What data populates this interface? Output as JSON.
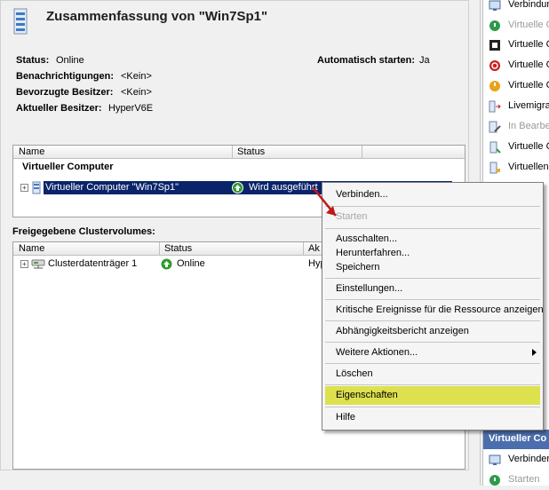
{
  "summary": {
    "title": "Zusammenfassung von \"Win7Sp1\"",
    "status_label": "Status:",
    "status_value": "Online",
    "notify_label": "Benachrichtigungen:",
    "notify_value": "<Kein>",
    "preferred_label": "Bevorzugte Besitzer:",
    "preferred_value": "<Kein>",
    "owner_label": "Aktueller Besitzer:",
    "owner_value": "HyperV6E",
    "autostart_label": "Automatisch starten:",
    "autostart_value": "Ja"
  },
  "vm_table": {
    "col_name": "Name",
    "col_status": "Status",
    "group": "Virtueller Computer",
    "row_name": "Virtueller Computer \"Win7Sp1\"",
    "row_status": "Wird ausgeführt"
  },
  "volumes": {
    "heading": "Freigegebene Clustervolumes:",
    "col_name": "Name",
    "col_status": "Status",
    "col_3": "Ak",
    "row_name": "Clusterdatenträger 1",
    "row_status": "Online",
    "row_col3": "Hyp"
  },
  "context_menu": {
    "connect": "Verbinden...",
    "start": "Starten",
    "shutdown_off": "Ausschalten...",
    "shutdown": "Herunterfahren...",
    "save": "Speichern",
    "settings": "Einstellungen...",
    "critical_events": "Kritische Ereignisse für die Ressource anzeigen",
    "dependency_report": "Abhängigkeitsbericht anzeigen",
    "more_actions": "Weitere Aktionen...",
    "delete": "Löschen",
    "properties": "Eigenschaften",
    "help": "Hilfe",
    "highlight_color": "#dde14e"
  },
  "actions_pane": {
    "items": [
      {
        "label": "Verbindun",
        "icon": "connect-icon"
      },
      {
        "label": "Virtuelle C",
        "icon": "start-icon"
      },
      {
        "label": "Virtuelle C",
        "icon": "stop-icon"
      },
      {
        "label": "Virtuelle C",
        "icon": "power-off-icon"
      },
      {
        "label": "Virtuelle C",
        "icon": "shutdown-icon"
      },
      {
        "label": "Livemigra",
        "icon": "migration-icon"
      },
      {
        "label": "In Bearbe",
        "icon": "edit-icon"
      },
      {
        "label": "Virtuelle C",
        "icon": "vm-icon"
      },
      {
        "label": "Virtuellen",
        "icon": "vm-add-icon"
      }
    ],
    "section_header": "Virtueller Co",
    "bottom_items": [
      {
        "label": "Verbinder",
        "icon": "connect-icon"
      },
      {
        "label": "Starten",
        "icon": "start-icon"
      }
    ]
  }
}
